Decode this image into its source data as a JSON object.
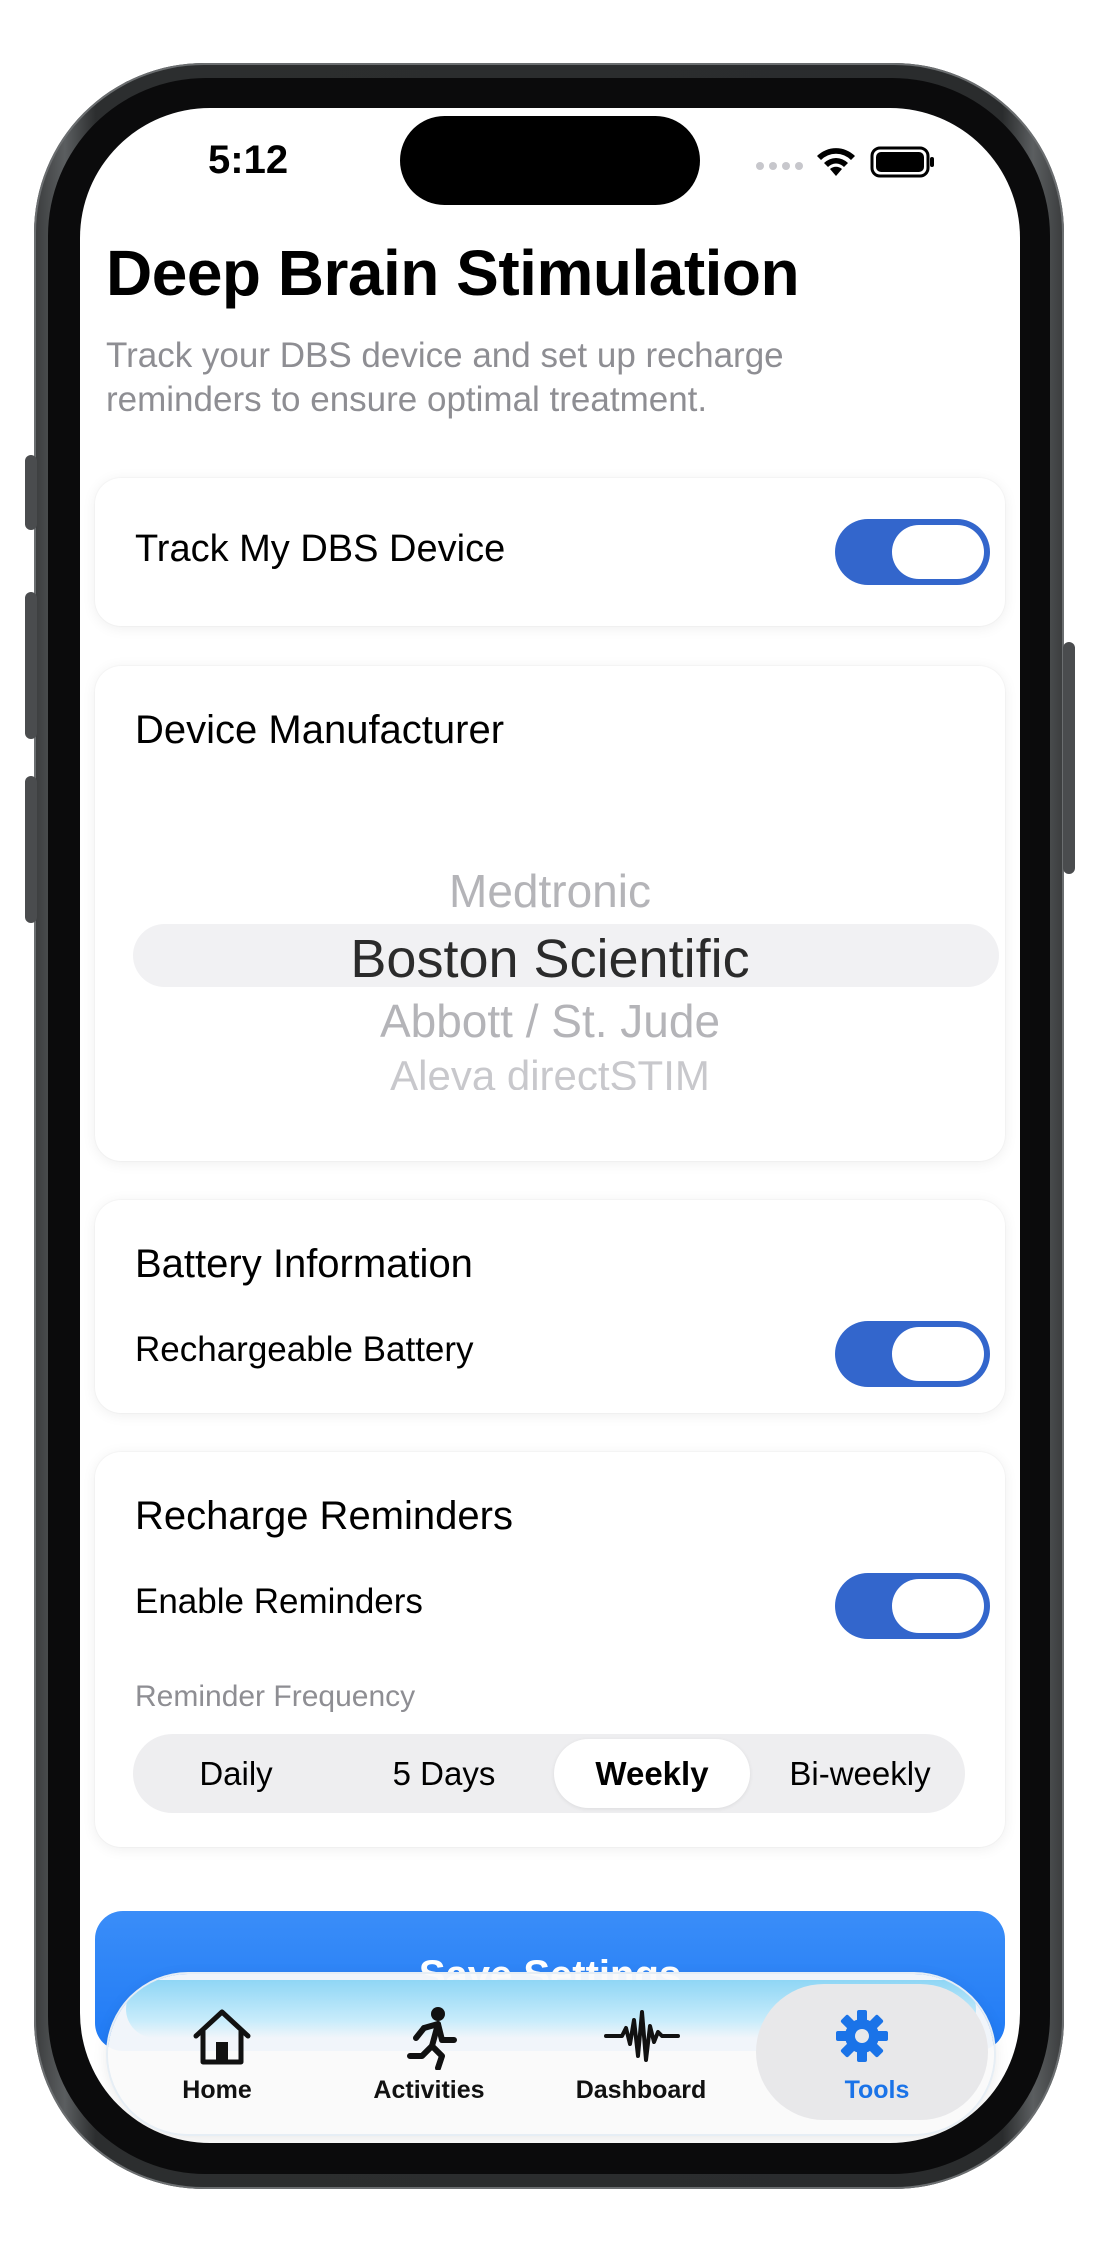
{
  "status_bar": {
    "time": "5:12"
  },
  "header": {
    "title": "Deep Brain Stimulation",
    "subtitle": "Track your DBS device and set up recharge reminders to ensure optimal treatment."
  },
  "track_card": {
    "label": "Track My DBS Device",
    "toggle_on": true
  },
  "manufacturer_card": {
    "title": "Device Manufacturer",
    "options": [
      "Medtronic",
      "Boston Scientific",
      "Abbott / St. Jude",
      "Aleva directSTIM"
    ],
    "selected": "Boston Scientific"
  },
  "battery_card": {
    "title": "Battery Information",
    "rechargeable_label": "Rechargeable Battery",
    "toggle_on": true
  },
  "reminders_card": {
    "title": "Recharge Reminders",
    "enable_label": "Enable Reminders",
    "toggle_on": true,
    "frequency_label": "Reminder Frequency",
    "frequency_options": [
      "Daily",
      "5 Days",
      "Weekly",
      "Bi-weekly"
    ],
    "selected_frequency": "Weekly"
  },
  "save_button": {
    "label": "Save Settings"
  },
  "tab_bar": {
    "tabs": [
      {
        "label": "Home",
        "icon": "house-icon"
      },
      {
        "label": "Activities",
        "icon": "running-figure-icon"
      },
      {
        "label": "Dashboard",
        "icon": "waveform-icon"
      },
      {
        "label": "Tools",
        "icon": "gear-icon"
      }
    ],
    "selected": "Tools"
  },
  "colors": {
    "accent": "#3366cc",
    "save_button": "#1f7af5",
    "selected_tab": "#1a73e8",
    "secondary_text": "#8e8e93"
  }
}
